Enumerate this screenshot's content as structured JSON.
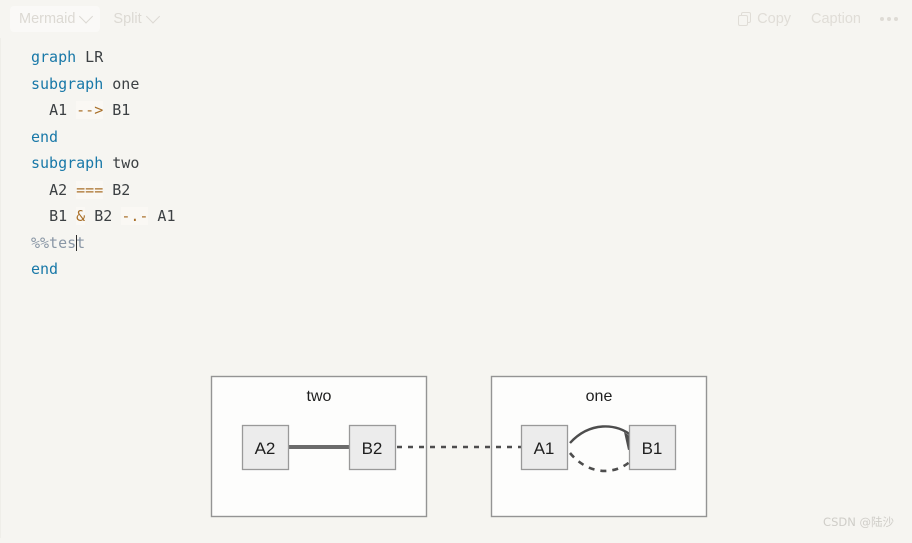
{
  "toolbar": {
    "language_label": "Mermaid",
    "view_label": "Split",
    "copy_label": "Copy",
    "caption_label": "Caption",
    "more_label": "•••",
    "copy_icon": "copy-icon",
    "chevron_icon": "chevron-down-icon"
  },
  "editor": {
    "lines": [
      {
        "indent": 0,
        "tokens": [
          {
            "t": "graph",
            "c": "kw"
          },
          {
            "t": " LR",
            "c": ""
          }
        ]
      },
      {
        "indent": 0,
        "tokens": [
          {
            "t": "subgraph",
            "c": "kw"
          },
          {
            "t": " one",
            "c": ""
          }
        ]
      },
      {
        "indent": 1,
        "tokens": [
          {
            "t": "A1 ",
            "c": ""
          },
          {
            "t": "-->",
            "c": "op"
          },
          {
            "t": " B1",
            "c": ""
          }
        ]
      },
      {
        "indent": 0,
        "tokens": [
          {
            "t": "end",
            "c": "kw"
          }
        ]
      },
      {
        "indent": 0,
        "tokens": [
          {
            "t": "subgraph",
            "c": "kw"
          },
          {
            "t": " two",
            "c": ""
          }
        ]
      },
      {
        "indent": 1,
        "tokens": [
          {
            "t": "A2 ",
            "c": ""
          },
          {
            "t": "===",
            "c": "op"
          },
          {
            "t": " B2",
            "c": ""
          }
        ]
      },
      {
        "indent": 1,
        "tokens": [
          {
            "t": "B1 ",
            "c": ""
          },
          {
            "t": "&",
            "c": "op"
          },
          {
            "t": " B2 ",
            "c": ""
          },
          {
            "t": "-.-",
            "c": "op"
          },
          {
            "t": " A1",
            "c": ""
          }
        ]
      },
      {
        "indent": 0,
        "tokens": [
          {
            "t": "%%tes",
            "c": "cmt"
          },
          {
            "t": "",
            "c": "cursor"
          },
          {
            "t": "t",
            "c": "cmt"
          }
        ]
      },
      {
        "indent": 0,
        "tokens": [
          {
            "t": "end",
            "c": "kw"
          }
        ]
      }
    ],
    "raw_text": "graph LR\nsubgraph one\n  A1 --> B1\nend\nsubgraph two\n  A2 === B2\n  B1 & B2 -.- A1\n%%test\nend"
  },
  "diagram": {
    "type": "flowchart",
    "direction": "LR",
    "subgraphs": [
      {
        "id": "two",
        "title": "two",
        "nodes": [
          "A2",
          "B2"
        ]
      },
      {
        "id": "one",
        "title": "one",
        "nodes": [
          "A1",
          "B1"
        ]
      }
    ],
    "nodes": [
      {
        "id": "A2",
        "label": "A2"
      },
      {
        "id": "B2",
        "label": "B2"
      },
      {
        "id": "A1",
        "label": "A1"
      },
      {
        "id": "B1",
        "label": "B1"
      }
    ],
    "edges": [
      {
        "from": "A1",
        "to": "B1",
        "style": "arrow"
      },
      {
        "from": "A2",
        "to": "B2",
        "style": "thick"
      },
      {
        "from": "B1",
        "to": "A1",
        "style": "dotted"
      },
      {
        "from": "B2",
        "to": "A1",
        "style": "dotted"
      }
    ],
    "colors": {
      "node_fill": "#ececec",
      "node_stroke": "#999999",
      "subgraph_fill": "#fdfdfc",
      "subgraph_stroke": "#949494",
      "edge": "#4d4d4d"
    }
  },
  "watermark": {
    "text": "CSDN @陆沙"
  }
}
